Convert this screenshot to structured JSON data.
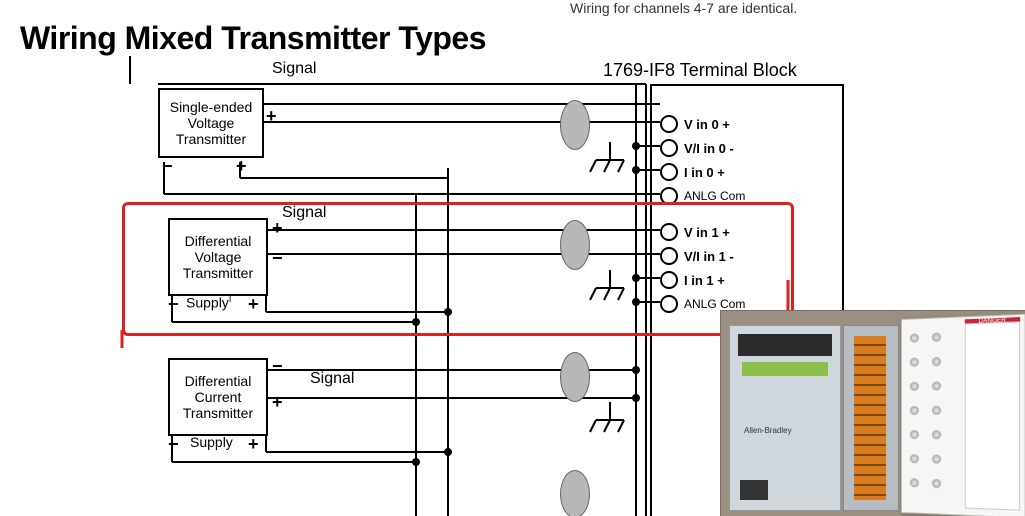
{
  "title": "Wiring Mixed Transmitter Types",
  "top_note": "Wiring for channels 4-7 are identical.",
  "terminal_block_label": "1769-IF8 Terminal Block",
  "signal_word": "Signal",
  "supply_word": "Supply",
  "transmitters": {
    "t1": "Single-ended\nVoltage\nTransmitter",
    "t2": "Differential\nVoltage\nTransmitter",
    "t3": "Differential\nCurrent\nTransmitter"
  },
  "terminals": {
    "r0": "V in 0 +",
    "r1": "V/I in 0 -",
    "r2": "I in 0 +",
    "r3": "ANLG Com",
    "r4": "V in 1 +",
    "r5": "V/I in 1 -",
    "r6": "I in 1 +",
    "r7": "ANLG Com"
  },
  "signs": {
    "plus": "+",
    "minus": "−"
  },
  "photo": {
    "brand": "Allen-Bradley",
    "danger": "DANGER"
  }
}
